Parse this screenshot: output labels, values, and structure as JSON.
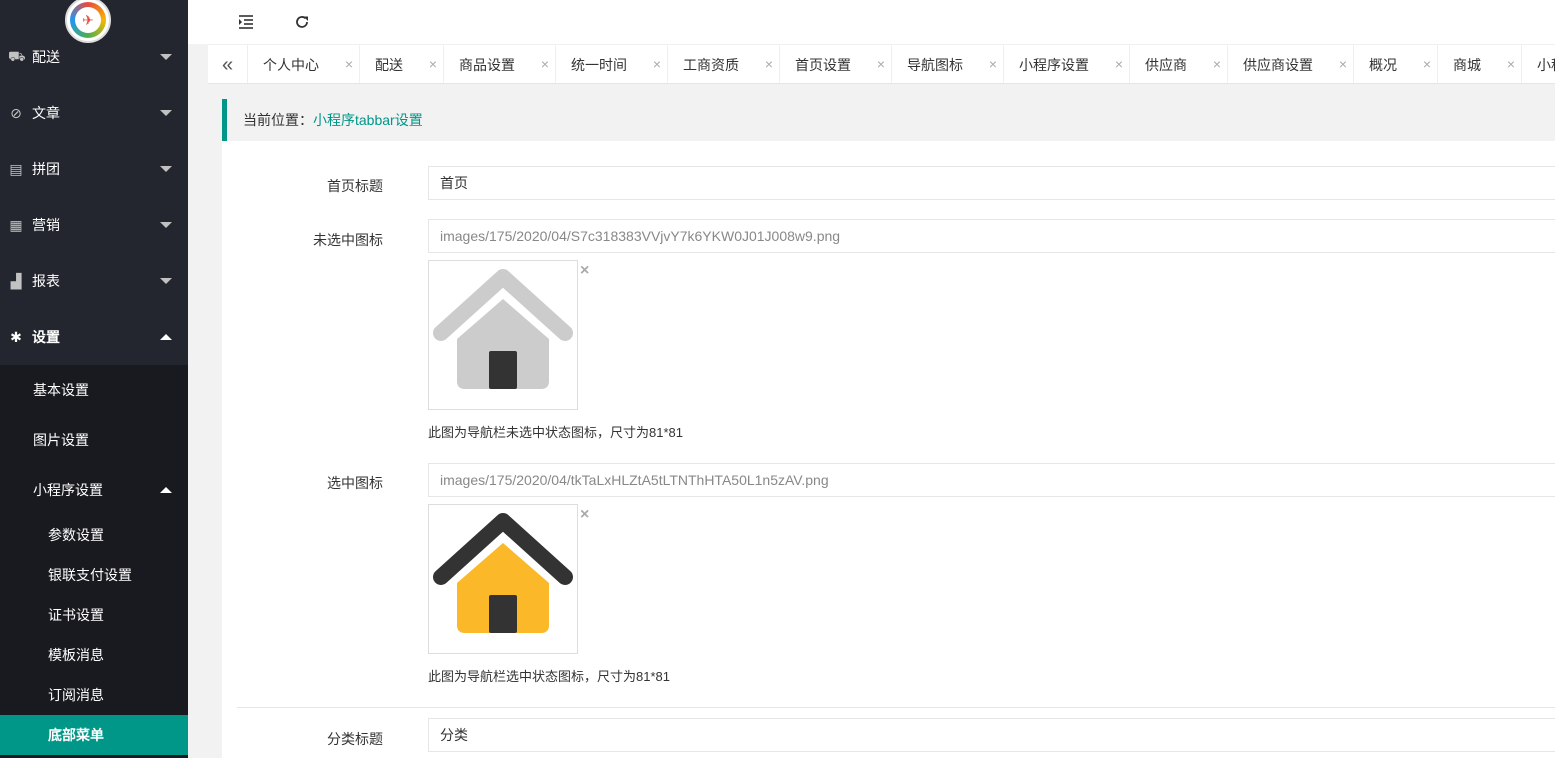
{
  "sidebar": {
    "logo_icon": "plane-logo-icon",
    "items": [
      {
        "label": "配送",
        "icon": "truck-icon",
        "expanded": false
      },
      {
        "label": "文章",
        "icon": "compass-icon",
        "expanded": false
      },
      {
        "label": "拼团",
        "icon": "group-icon",
        "expanded": false
      },
      {
        "label": "营销",
        "icon": "gift-icon",
        "expanded": false
      },
      {
        "label": "报表",
        "icon": "bar-chart-icon",
        "expanded": false
      },
      {
        "label": "设置",
        "icon": "gear-icon",
        "expanded": true
      }
    ],
    "sub_items": [
      {
        "label": "基本设置"
      },
      {
        "label": "图片设置"
      },
      {
        "label": "小程序设置",
        "expanded": true
      }
    ],
    "sub2_items": [
      {
        "label": "参数设置"
      },
      {
        "label": "银联支付设置"
      },
      {
        "label": "证书设置"
      },
      {
        "label": "模板消息"
      },
      {
        "label": "订阅消息"
      },
      {
        "label": "底部菜单",
        "active": true
      }
    ]
  },
  "header": {
    "menu_toggle_icon": "indent-icon",
    "refresh_icon": "refresh-icon"
  },
  "tabs": [
    {
      "label": "个人中心"
    },
    {
      "label": "配送"
    },
    {
      "label": "商品设置"
    },
    {
      "label": "统一时间"
    },
    {
      "label": "工商资质"
    },
    {
      "label": "首页设置"
    },
    {
      "label": "导航图标"
    },
    {
      "label": "小程序设置"
    },
    {
      "label": "供应商"
    },
    {
      "label": "供应商设置"
    },
    {
      "label": "概况"
    },
    {
      "label": "商城"
    },
    {
      "label": "小程"
    }
  ],
  "tab_close": "×",
  "breadcrumb": {
    "prefix": "当前位置：",
    "current": "小程序tabbar设置"
  },
  "form": {
    "home_title_label": "首页标题",
    "home_title_value": "首页",
    "unselected_icon_label": "未选中图标",
    "unselected_icon_path": "images/175/2020/04/S7c318383VVjvY7k6YKW0J01J008w9.png",
    "unselected_hint": "此图为导航栏未选中状态图标，尺寸为81*81",
    "selected_icon_label": "选中图标",
    "selected_icon_path": "images/175/2020/04/tkTaLxHLZtA5tLTNThHTA50L1n5zAV.png",
    "selected_hint": "此图为导航栏选中状态图标，尺寸为81*81",
    "category_title_label": "分类标题",
    "category_title_value": "分类",
    "remove_glyph": "×"
  },
  "colors": {
    "accent": "#009688",
    "sidebar_bg": "#23262e",
    "subnav_bg": "#181a1f",
    "house_gray": "#cccccc",
    "house_yellow": "#fbb829",
    "house_dark": "#333333"
  }
}
